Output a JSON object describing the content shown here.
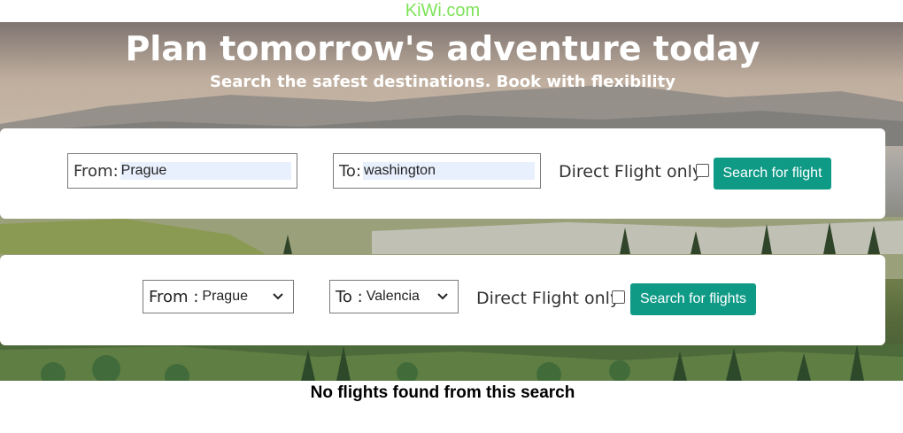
{
  "brand": {
    "name": "KiWi.com",
    "color": "#7ee35a"
  },
  "hero": {
    "title": "Plan tomorrow's adventure today",
    "subtitle": "Search the safest destinations. Book with flexibility"
  },
  "search_form_1": {
    "from_label": "From:",
    "from_value": "Prague",
    "to_label": "To:",
    "to_value": "washington",
    "direct_label": "Direct Flight only",
    "direct_checked": false,
    "button_label": "Search for flight"
  },
  "search_form_2": {
    "from_label": "From :",
    "from_value": "Prague",
    "to_label": "To :",
    "to_value": "Valencia",
    "direct_label": "Direct Flight only",
    "direct_checked": false,
    "button_label": "Search for flights"
  },
  "results": {
    "message": "No flights found from this search"
  },
  "colors": {
    "button": "#0f9a86",
    "autofill": "#e8f0fe"
  },
  "icons": [
    "chevron-down-icon",
    "checkbox-icon"
  ]
}
